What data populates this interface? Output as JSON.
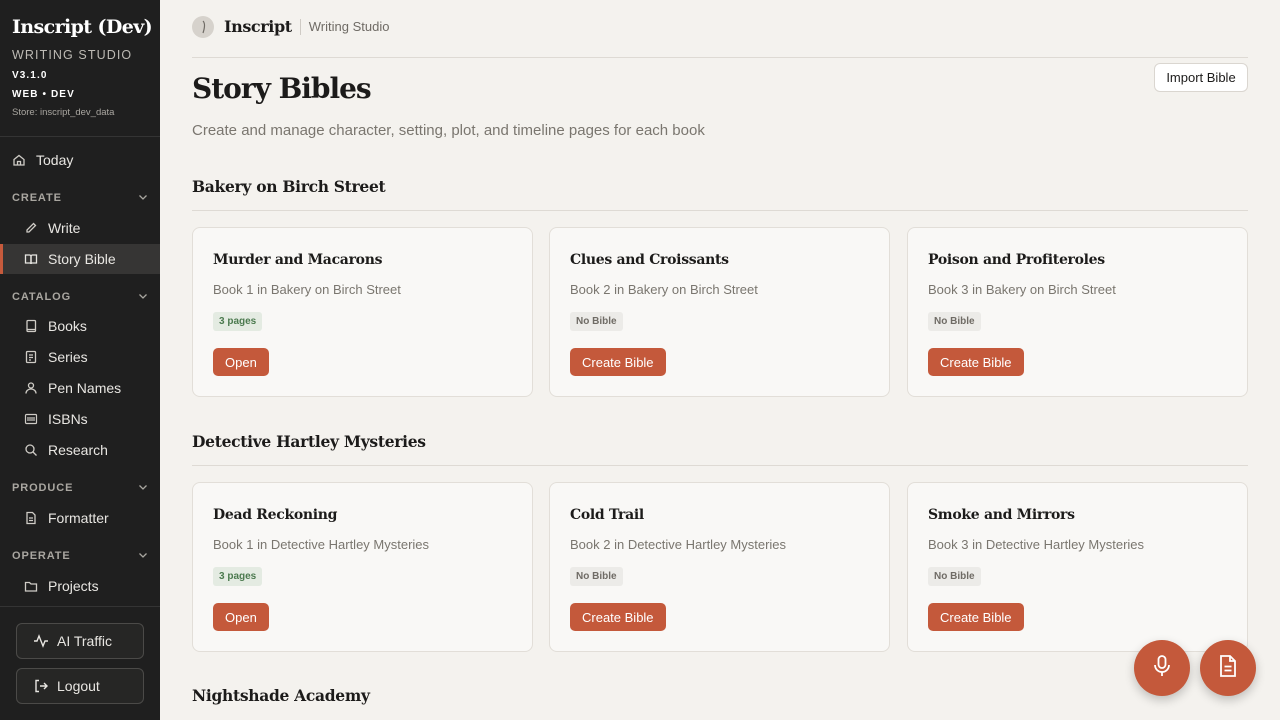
{
  "app": {
    "title": "Inscript (Dev)",
    "subtitle": "WRITING STUDIO",
    "version": "V3.1.0",
    "env": "WEB • DEV",
    "store": "Store: inscript_dev_data"
  },
  "colors": {
    "accent": "#c4593b",
    "sidebar_bg": "#1f1f1f",
    "page_bg": "#f4f2ee"
  },
  "sidebar": {
    "today": "Today",
    "sections": {
      "create": "CREATE",
      "catalog": "CATALOG",
      "produce": "PRODUCE",
      "operate": "OPERATE"
    },
    "items": {
      "write": "Write",
      "story_bible": "Story Bible",
      "books": "Books",
      "series": "Series",
      "pen_names": "Pen Names",
      "isbns": "ISBNs",
      "research": "Research",
      "formatter": "Formatter",
      "projects": "Projects"
    },
    "ai_traffic": "AI Traffic",
    "logout": "Logout"
  },
  "header": {
    "brand": "Inscript",
    "section": "Writing Studio"
  },
  "page": {
    "title": "Story Bibles",
    "subtitle": "Create and manage character, setting, plot, and timeline pages for each book",
    "import_button": "Import Bible"
  },
  "series": [
    {
      "name": "Bakery on Birch Street",
      "books": [
        {
          "title": "Murder and Macarons",
          "meta": "Book 1 in Bakery on Birch Street",
          "badge": "3 pages",
          "has_bible": true,
          "action": "Open"
        },
        {
          "title": "Clues and Croissants",
          "meta": "Book 2 in Bakery on Birch Street",
          "badge": "No Bible",
          "has_bible": false,
          "action": "Create Bible"
        },
        {
          "title": "Poison and Profiteroles",
          "meta": "Book 3 in Bakery on Birch Street",
          "badge": "No Bible",
          "has_bible": false,
          "action": "Create Bible"
        }
      ]
    },
    {
      "name": "Detective Hartley Mysteries",
      "books": [
        {
          "title": "Dead Reckoning",
          "meta": "Book 1 in Detective Hartley Mysteries",
          "badge": "3 pages",
          "has_bible": true,
          "action": "Open"
        },
        {
          "title": "Cold Trail",
          "meta": "Book 2 in Detective Hartley Mysteries",
          "badge": "No Bible",
          "has_bible": false,
          "action": "Create Bible"
        },
        {
          "title": "Smoke and Mirrors",
          "meta": "Book 3 in Detective Hartley Mysteries",
          "badge": "No Bible",
          "has_bible": false,
          "action": "Create Bible"
        }
      ]
    },
    {
      "name": "Nightshade Academy",
      "books": []
    }
  ],
  "icons": {
    "today": "home-icon",
    "write": "pencil-icon",
    "story_bible": "book-open-icon",
    "books": "book-icon",
    "series": "layers-icon",
    "pen_names": "user-icon",
    "isbns": "barcode-icon",
    "research": "search-icon",
    "formatter": "document-icon",
    "projects": "folder-icon",
    "ai_traffic": "activity-icon",
    "logout": "logout-icon",
    "fab_mic": "microphone-icon",
    "fab_doc": "document-icon"
  }
}
